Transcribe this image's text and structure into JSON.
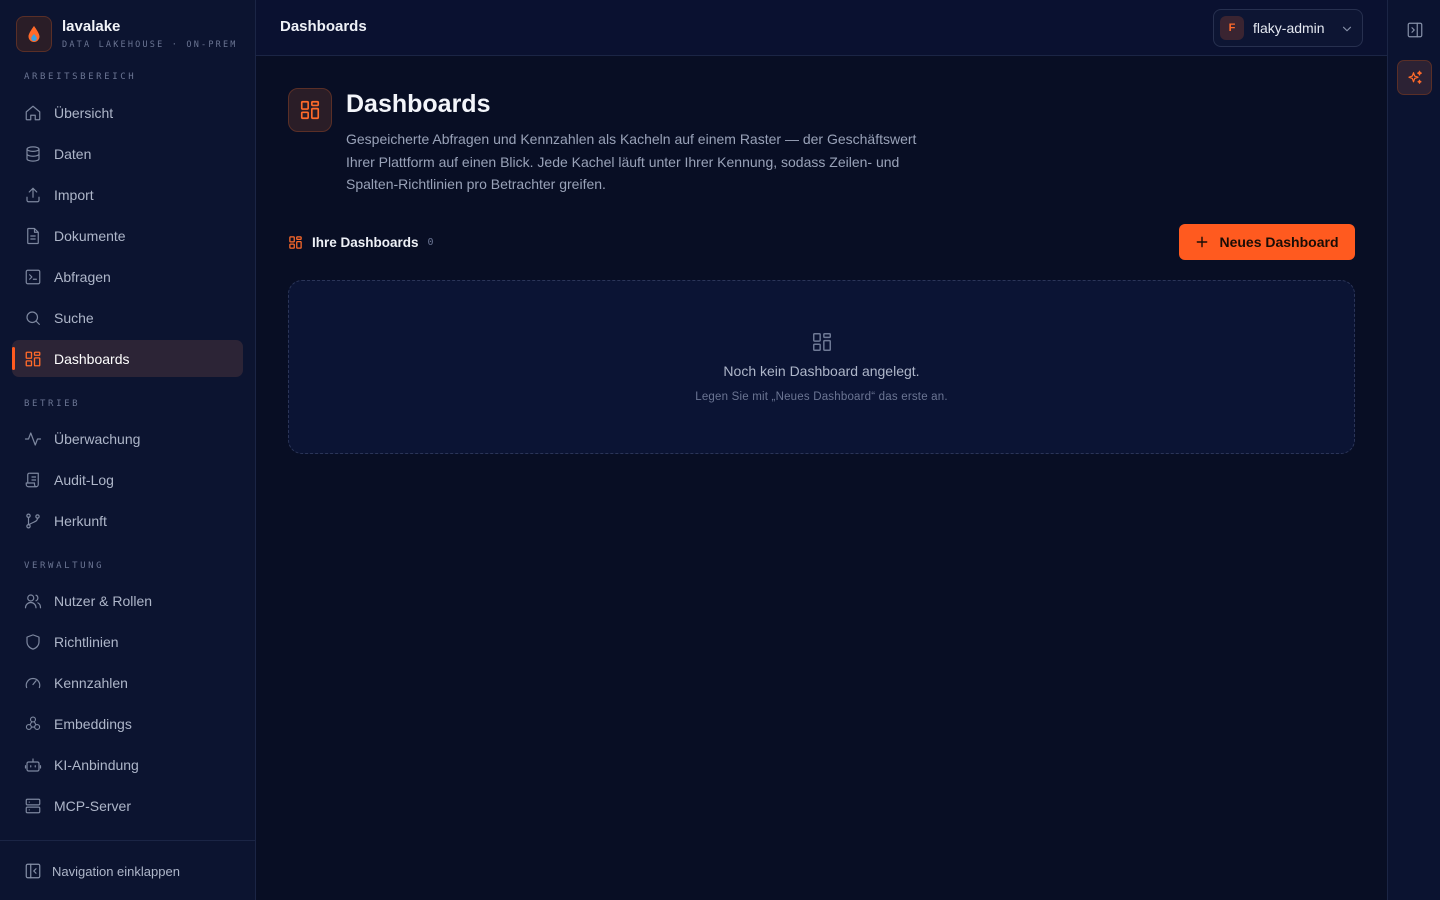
{
  "brand": {
    "name": "lavalake",
    "subtitle": "DATA LAKEHOUSE · ON-PREM"
  },
  "sidebar": {
    "sections": [
      {
        "title": "ARBEITSBEREICH",
        "items": [
          {
            "label": "Übersicht",
            "icon": "home-icon"
          },
          {
            "label": "Daten",
            "icon": "database-icon"
          },
          {
            "label": "Import",
            "icon": "upload-icon"
          },
          {
            "label": "Dokumente",
            "icon": "document-icon"
          },
          {
            "label": "Abfragen",
            "icon": "terminal-icon"
          },
          {
            "label": "Suche",
            "icon": "search-icon"
          },
          {
            "label": "Dashboards",
            "icon": "dashboard-grid-icon",
            "active": true
          }
        ]
      },
      {
        "title": "BETRIEB",
        "items": [
          {
            "label": "Überwachung",
            "icon": "activity-icon"
          },
          {
            "label": "Audit-Log",
            "icon": "scroll-icon"
          },
          {
            "label": "Herkunft",
            "icon": "git-branch-icon"
          }
        ]
      },
      {
        "title": "VERWALTUNG",
        "items": [
          {
            "label": "Nutzer & Rollen",
            "icon": "users-icon"
          },
          {
            "label": "Richtlinien",
            "icon": "shield-icon"
          },
          {
            "label": "Kennzahlen",
            "icon": "gauge-icon"
          },
          {
            "label": "Embeddings",
            "icon": "cubes-icon"
          },
          {
            "label": "KI-Anbindung",
            "icon": "bot-icon"
          },
          {
            "label": "MCP-Server",
            "icon": "server-icon"
          }
        ]
      }
    ],
    "collapse_label": "Navigation einklappen"
  },
  "topbar": {
    "title": "Dashboards",
    "user": {
      "initial": "F",
      "name": "flaky-admin"
    }
  },
  "main": {
    "title": "Dashboards",
    "description": "Gespeicherte Abfragen und Kennzahlen als Kacheln auf einem Raster — der Geschäftswert Ihrer Plattform auf einen Blick. Jede Kachel läuft unter Ihrer Kennung, sodass Zeilen- und Spalten-Richtlinien pro Betrachter greifen.",
    "section_label": "Ihre Dashboards",
    "section_count": "0",
    "new_button": "Neues Dashboard",
    "empty_title": "Noch kein Dashboard angelegt.",
    "empty_hint": "Legen Sie mit „Neues Dashboard“ das erste an."
  },
  "colors": {
    "background": "#080e24",
    "sidebar": "#0c1430",
    "accent": "#ff5a1f"
  }
}
